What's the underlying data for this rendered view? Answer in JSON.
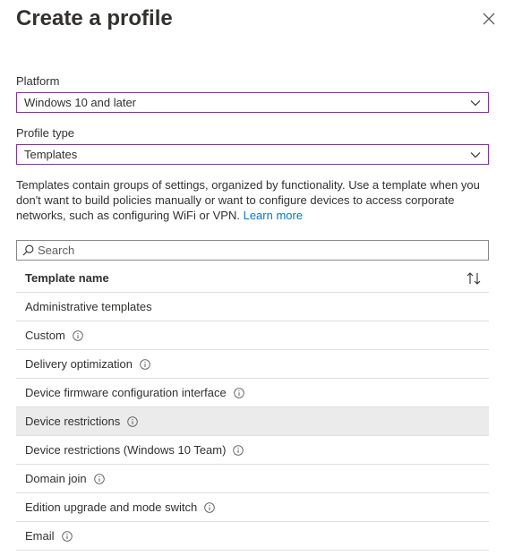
{
  "header": {
    "title": "Create a profile"
  },
  "platform": {
    "label": "Platform",
    "value": "Windows 10 and later"
  },
  "profile_type": {
    "label": "Profile type",
    "value": "Templates"
  },
  "description": {
    "text": "Templates contain groups of settings, organized by functionality. Use a template when you don't want to build policies manually or want to configure devices to access corporate networks, such as configuring WiFi or VPN. ",
    "link": "Learn more"
  },
  "search": {
    "placeholder": "Search"
  },
  "table": {
    "column_header": "Template name",
    "rows": [
      {
        "name": "Administrative templates",
        "info": false,
        "selected": false
      },
      {
        "name": "Custom",
        "info": true,
        "selected": false
      },
      {
        "name": "Delivery optimization",
        "info": true,
        "selected": false
      },
      {
        "name": "Device firmware configuration interface",
        "info": true,
        "selected": false
      },
      {
        "name": "Device restrictions",
        "info": true,
        "selected": true
      },
      {
        "name": "Device restrictions (Windows 10 Team)",
        "info": true,
        "selected": false
      },
      {
        "name": "Domain join",
        "info": true,
        "selected": false
      },
      {
        "name": "Edition upgrade and mode switch",
        "info": true,
        "selected": false
      },
      {
        "name": "Email",
        "info": true,
        "selected": false
      }
    ]
  },
  "icons": {
    "close": "close-icon",
    "chevron": "chevron-down-icon",
    "search": "search-icon",
    "sort": "sort-icon",
    "info": "info-icon"
  },
  "colors": {
    "dropdown_border": "#8a2da5",
    "link": "#0078d4",
    "selected_row": "#ebebeb"
  }
}
